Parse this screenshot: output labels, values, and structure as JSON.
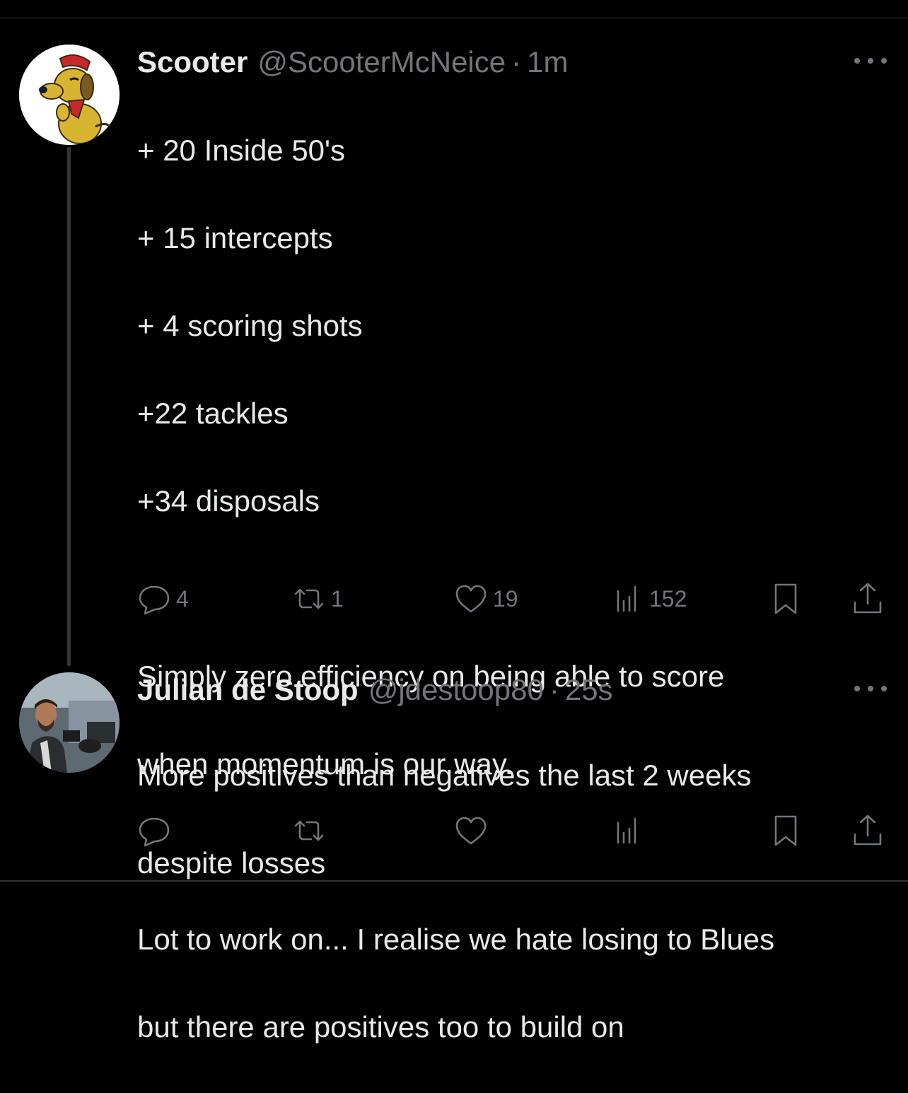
{
  "tweets": [
    {
      "name": "Scooter",
      "handle": "@ScooterMcNeice",
      "separator": "·",
      "time": "1m",
      "lines": [
        "+ 20 Inside 50's",
        "+ 15 intercepts",
        "+ 4 scoring shots",
        "+22 tackles",
        "+34 disposals",
        "",
        "Simply zero efficiency on being able to score",
        "when momentum is our way.",
        "",
        "Lot to work on... I realise we hate losing to Blues",
        "but there are positives too to build on"
      ],
      "replies": "4",
      "retweets": "1",
      "likes": "19",
      "views": "152"
    },
    {
      "name": "Julian de Stoop",
      "handle": "@jdestoop80",
      "separator": "·",
      "time": "25s",
      "lines": [
        "More positives than negatives the last 2 weeks",
        "despite losses"
      ]
    }
  ],
  "icons": {
    "more": "more-horizontal-icon",
    "reply": "reply-bubble-icon",
    "retweet": "retweet-icon",
    "like": "heart-icon",
    "views": "views-bar-chart-icon",
    "bookmark": "bookmark-icon",
    "share": "share-upload-icon"
  },
  "colors": {
    "background": "#000000",
    "text": "#e7e9ea",
    "secondary": "#71767b",
    "divider": "#2f3336"
  }
}
